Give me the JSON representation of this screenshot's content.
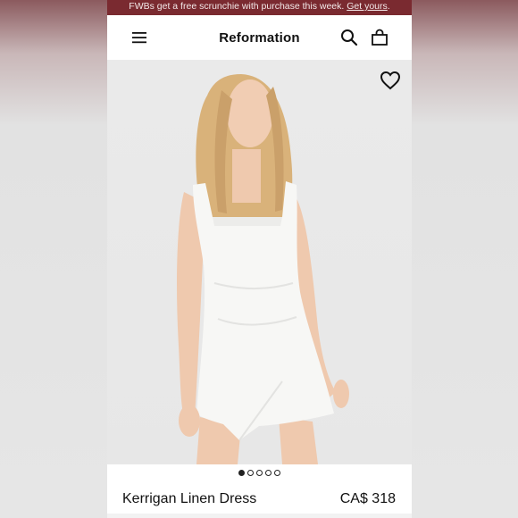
{
  "promo": {
    "text": "FWBs get a free scrunchie with purchase this week. ",
    "link": "Get yours",
    "suffix": "."
  },
  "header": {
    "brand": "Reformation",
    "icons": [
      "menu-icon",
      "search-icon",
      "bag-icon"
    ]
  },
  "product": {
    "name": "Kerrigan Linen Dress",
    "price": "CA$ 318",
    "image_alt": "model-in-white-linen-dress",
    "favorite_icon": "heart-outline-icon"
  },
  "carousel": {
    "total": 5,
    "active": 1
  },
  "colors": {
    "promo_bg": "#7a2a30",
    "text": "#111111"
  }
}
